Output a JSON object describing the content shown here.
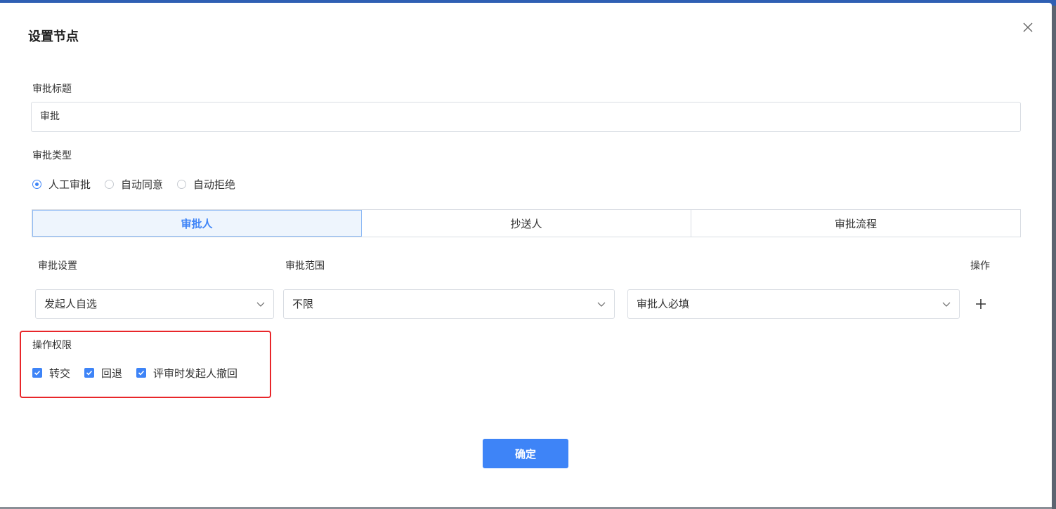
{
  "dialog": {
    "title": "设置节点"
  },
  "approval_title": {
    "label": "审批标题",
    "value": "审批"
  },
  "approval_type": {
    "label": "审批类型",
    "options": [
      {
        "label": "人工审批",
        "selected": true
      },
      {
        "label": "自动同意",
        "selected": false
      },
      {
        "label": "自动拒绝",
        "selected": false
      }
    ]
  },
  "tabs": [
    {
      "label": "审批人",
      "active": true
    },
    {
      "label": "抄送人",
      "active": false
    },
    {
      "label": "审批流程",
      "active": false
    }
  ],
  "columns": {
    "setting": "审批设置",
    "scope": "审批范围",
    "action": "操作"
  },
  "row": {
    "setting_value": "发起人自选",
    "scope_value": "不限",
    "required_value": "审批人必填"
  },
  "permissions": {
    "label": "操作权限",
    "items": [
      {
        "label": "转交",
        "checked": true
      },
      {
        "label": "回退",
        "checked": true
      },
      {
        "label": "评审时发起人撤回",
        "checked": true
      }
    ]
  },
  "footer": {
    "confirm_label": "确定"
  },
  "colors": {
    "accent": "#3e84f7",
    "highlight": "#e8262a"
  }
}
